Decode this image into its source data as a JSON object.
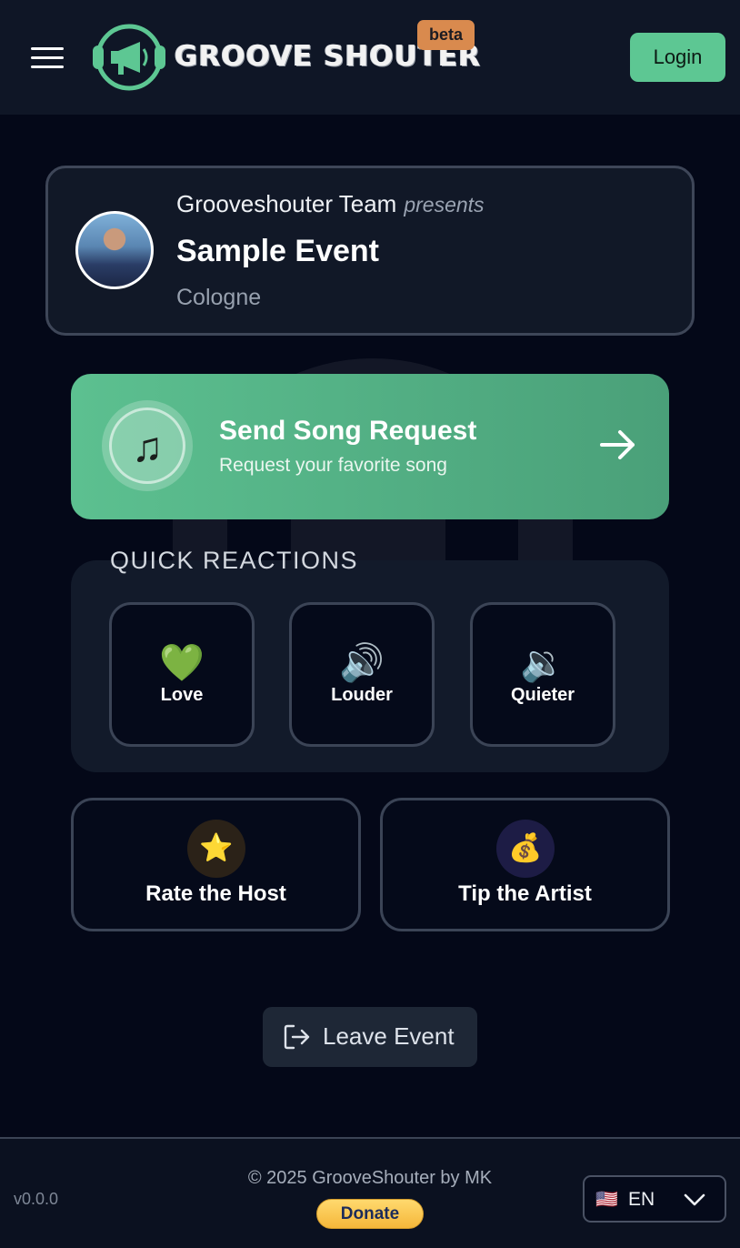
{
  "header": {
    "brand_name": "GROOVE SHOUTER",
    "beta_badge": "beta",
    "login_label": "Login"
  },
  "event": {
    "host_name": "Grooveshouter Team",
    "presents_label": "presents",
    "title": "Sample Event",
    "city": "Cologne"
  },
  "song_request": {
    "title": "Send Song Request",
    "subtitle": "Request your favorite song",
    "icon": "music-note-icon"
  },
  "quick_reactions": {
    "heading": "QUICK REACTIONS",
    "items": [
      {
        "label": "Love",
        "emoji": "💚",
        "icon": "green-heart-icon"
      },
      {
        "label": "Louder",
        "emoji": "🔊",
        "icon": "speaker-loud-icon"
      },
      {
        "label": "Quieter",
        "emoji": "🔉",
        "icon": "speaker-quiet-icon"
      }
    ]
  },
  "actions": {
    "rate_host": {
      "label": "Rate the Host",
      "emoji": "⭐",
      "icon": "star-icon"
    },
    "tip_artist": {
      "label": "Tip the Artist",
      "emoji": "💰",
      "icon": "money-bag-icon"
    }
  },
  "leave_event": {
    "label": "Leave Event",
    "icon": "logout-icon"
  },
  "footer": {
    "version": "v0.0.0",
    "copyright": "© 2025 GrooveShouter by MK",
    "donate_label": "Donate",
    "language": {
      "flag": "🇺🇸",
      "code": "EN"
    }
  },
  "colors": {
    "accent_green": "#5dc793",
    "beta_orange": "#d98a4e",
    "background": "#040818",
    "card_border": "#3b4456"
  }
}
